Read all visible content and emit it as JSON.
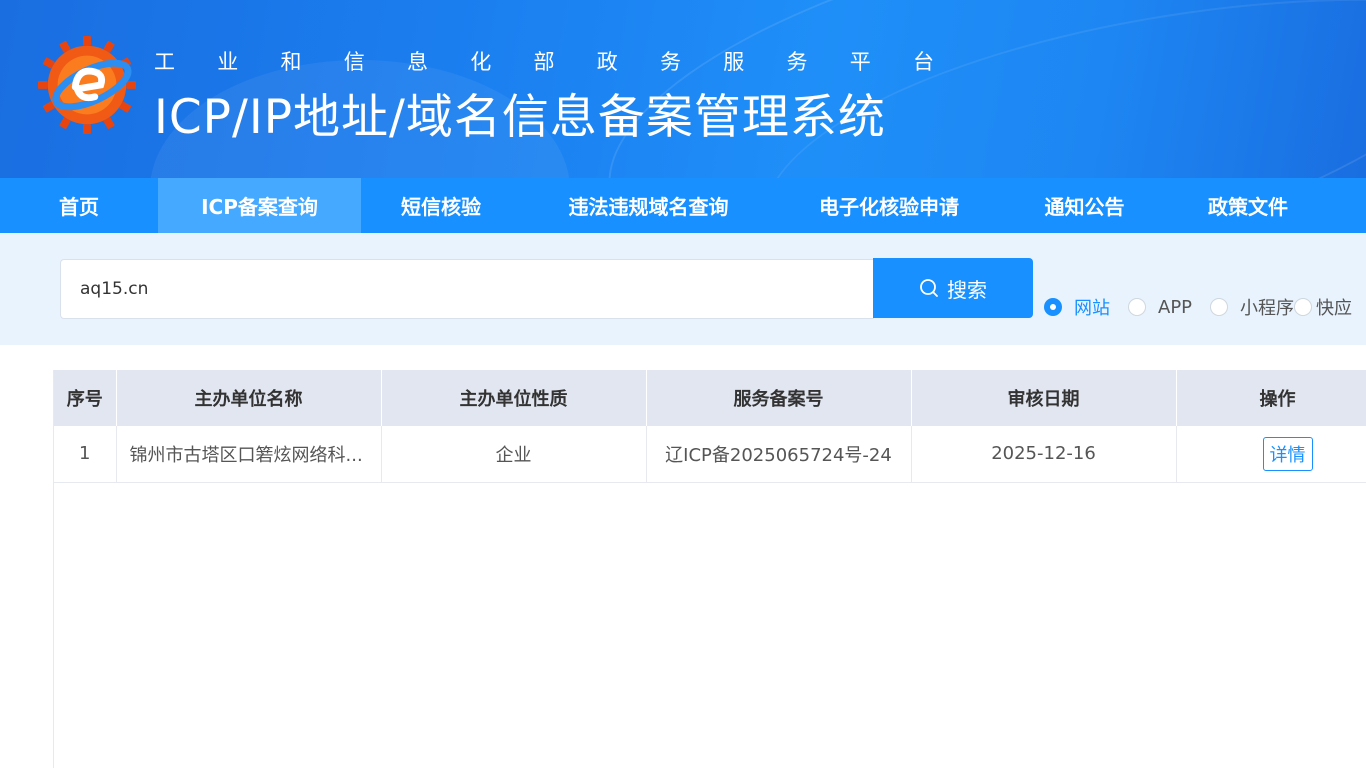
{
  "header": {
    "subtitle_chars": [
      "工",
      "业",
      "和",
      "信",
      "息",
      "化",
      "部",
      "政",
      "务",
      "服",
      "务",
      "平",
      "台"
    ],
    "title": "ICP/IP地址/域名信息备案管理系统",
    "logo_icon": "miit-logo-icon"
  },
  "nav": {
    "items": [
      {
        "label": "首页",
        "active": false
      },
      {
        "label": "ICP备案查询",
        "active": true
      },
      {
        "label": "短信核验",
        "active": false
      },
      {
        "label": "违法违规域名查询",
        "active": false
      },
      {
        "label": "电子化核验申请",
        "active": false
      },
      {
        "label": "通知公告",
        "active": false
      },
      {
        "label": "政策文件",
        "active": false
      }
    ]
  },
  "search": {
    "value": "aq15.cn",
    "button_label": "搜索",
    "types": [
      {
        "label": "网站",
        "checked": true
      },
      {
        "label": "APP",
        "checked": false
      },
      {
        "label": "小程序",
        "checked": false
      },
      {
        "label": "快应",
        "checked": false
      }
    ]
  },
  "table": {
    "headers": [
      "序号",
      "主办单位名称",
      "主办单位性质",
      "服务备案号",
      "审核日期",
      "操作"
    ],
    "rows": [
      {
        "index": "1",
        "org_name": "锦州市古塔区口箬炫网络科...",
        "org_type": "企业",
        "license": "辽ICP备2025065724号-24",
        "date": "2025-12-16",
        "action": "详情"
      }
    ]
  },
  "colors": {
    "primary": "#1890ff",
    "nav_active": "#45a9ff",
    "search_bg": "#e8f3fd",
    "table_header_bg": "#e1e6f0"
  }
}
